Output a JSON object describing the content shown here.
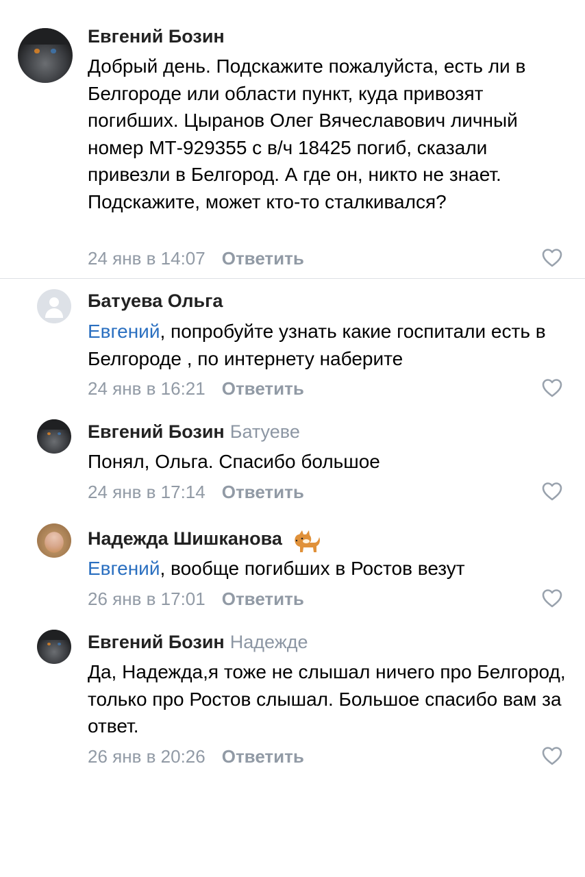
{
  "comments": [
    {
      "author": "Евгений Бозин",
      "reply_to": "",
      "mention": "",
      "text": "Добрый день. Подскажите пожалуйста, есть ли в Белгороде или области пункт, куда привозят погибших. Цыранов Олег Вячеславович личный номер МТ-929355 с в/ч 18425 погиб, сказали привезли в Белгород. А где он, никто не знает. Подскажите, может кто-то сталкивался?",
      "time": "24 янв в 14:07",
      "reply_label": "Ответить",
      "avatar_icon": "cat-avatar"
    },
    {
      "author": "Батуева Ольга",
      "reply_to": "",
      "mention": "Евгений",
      "text": ", попробуйте узнать какие госпитали есть в Белгороде , по интернету наберите",
      "time": "24 янв в 16:21",
      "reply_label": "Ответить",
      "avatar_icon": "default-user-icon"
    },
    {
      "author": "Евгений Бозин",
      "reply_to": "Батуеве",
      "mention": "",
      "text": "Понял, Ольга. Спасибо большое",
      "time": "24 янв в 17:14",
      "reply_label": "Ответить",
      "avatar_icon": "cat-avatar"
    },
    {
      "author": "Надежда Шишканова",
      "reply_to": "",
      "mention": "Евгений",
      "text": ", вообще погибших в Ростов везут",
      "time": "26 янв в 17:01",
      "reply_label": "Ответить",
      "avatar_icon": "photo-avatar",
      "name_emoji": "dog-emoji"
    },
    {
      "author": "Евгений Бозин",
      "reply_to": "Надежде",
      "mention": "",
      "text": "Да, Надежда,я тоже не слышал ничего про Белгород, только про Ростов слышал. Большое спасибо вам за ответ.",
      "time": "26 янв в 20:26",
      "reply_label": "Ответить",
      "avatar_icon": "cat-avatar"
    }
  ],
  "colors": {
    "name": "#222222",
    "mention": "#2a6fc0",
    "meta": "#919aa5",
    "divider": "#dde0e4"
  }
}
